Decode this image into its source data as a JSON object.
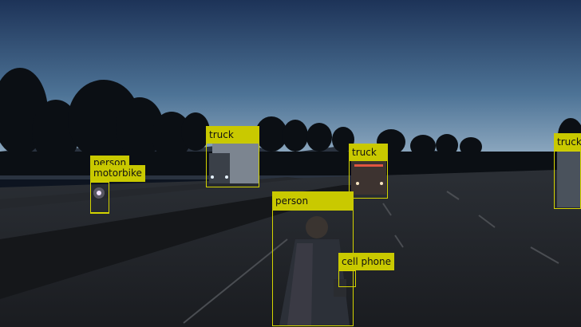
{
  "colors": {
    "box": "#d4d400",
    "label_bg": "#c9c900",
    "label_text": "#111111",
    "sky_top": "#1d3358",
    "sky_mid": "#4d7396",
    "sky_horizon": "#9fb7cb",
    "road": "#1f2226"
  },
  "detections": [
    {
      "id": "person-far",
      "label": "person"
    },
    {
      "id": "motorbike",
      "label": "motorbike"
    },
    {
      "id": "truck-left",
      "label": "truck"
    },
    {
      "id": "truck-center",
      "label": "truck"
    },
    {
      "id": "truck-right",
      "label": "truck"
    },
    {
      "id": "person-near",
      "label": "person"
    },
    {
      "id": "cell-phone",
      "label": "cell phone"
    }
  ]
}
